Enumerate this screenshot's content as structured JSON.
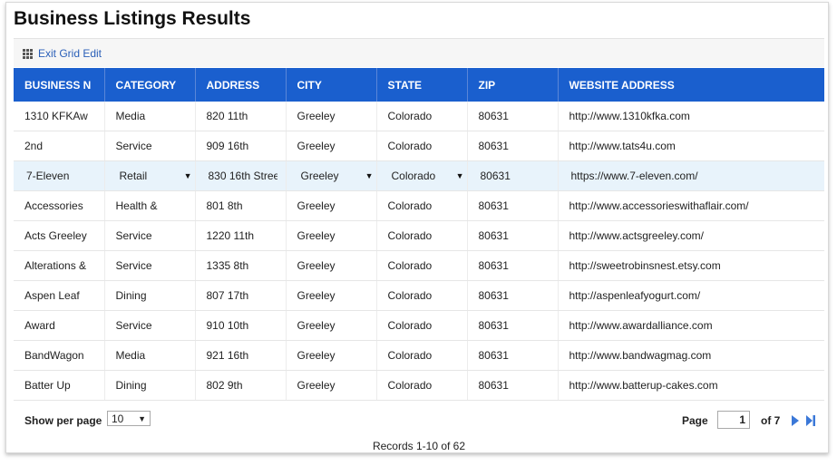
{
  "page": {
    "title": "Business Listings Results"
  },
  "toolbar": {
    "exit_grid_label": "Exit Grid Edit",
    "grid_icon": "grid-icon"
  },
  "table": {
    "columns": [
      "BUSINESS N",
      "CATEGORY",
      "ADDRESS",
      "CITY",
      "STATE",
      "ZIP",
      "WEBSITE ADDRESS"
    ],
    "rows": [
      [
        "1310 KFKAw",
        "Media",
        "820 11th",
        "Greeley",
        "Colorado",
        "80631",
        "http://www.1310kfka.com"
      ],
      [
        "2nd",
        "Service",
        "909 16th",
        "Greeley",
        "Colorado",
        "80631",
        "http://www.tats4u.com"
      ],
      [
        "7-Eleven",
        "Retail",
        "830 16th Stree",
        "Greeley",
        "Colorado",
        "80631",
        "https://www.7-eleven.com/"
      ],
      [
        "Accessories",
        "Health &",
        "801 8th",
        "Greeley",
        "Colorado",
        "80631",
        "http://www.accessorieswithaflair.com/"
      ],
      [
        "Acts Greeley",
        "Service",
        "1220 11th",
        "Greeley",
        "Colorado",
        "80631",
        "http://www.actsgreeley.com/"
      ],
      [
        "Alterations &",
        "Service",
        "1335 8th",
        "Greeley",
        "Colorado",
        "80631",
        "http://sweetrobinsnest.etsy.com"
      ],
      [
        "Aspen Leaf",
        "Dining",
        "807 17th",
        "Greeley",
        "Colorado",
        "80631",
        "http://aspenleafyogurt.com/"
      ],
      [
        "Award",
        "Service",
        "910 10th",
        "Greeley",
        "Colorado",
        "80631",
        "http://www.awardalliance.com"
      ],
      [
        "BandWagon",
        "Media",
        "921 16th",
        "Greeley",
        "Colorado",
        "80631",
        "http://www.bandwagmag.com"
      ],
      [
        "Batter Up",
        "Dining",
        "802 9th",
        "Greeley",
        "Colorado",
        "80631",
        "http://www.batterup-cakes.com"
      ]
    ],
    "editing_row_index": 2,
    "dropdown_caret": "▼"
  },
  "footer": {
    "show_per_page_label": "Show per page",
    "per_page_value": "10",
    "records_text": "Records 1-10 of 62",
    "page_label": "Page",
    "page_value": "1",
    "of_pages": "of 7",
    "next_icon": "next-page-icon",
    "last_icon": "last-page-icon"
  },
  "colors": {
    "header_bg": "#1a5fce",
    "selected_row_bg": "#e8f3fb",
    "link": "#2a5fb8",
    "pager_arrow": "#3b78d8"
  }
}
